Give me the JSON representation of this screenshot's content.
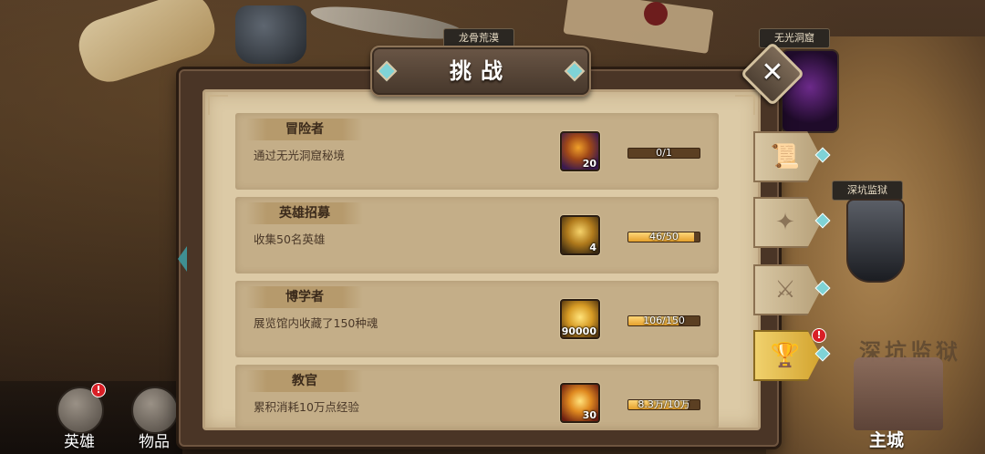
{
  "dialog": {
    "title": "挑战",
    "close_symbol": "✕"
  },
  "map": {
    "locations": [
      "龙骨荒漠",
      "无光洞窟",
      "深坑监狱"
    ],
    "map_text": "深坑监狱",
    "city_label": "主城"
  },
  "nav": {
    "heroes_label": "英雄",
    "items_label": "物品",
    "heroes_badge": "!"
  },
  "challenges": [
    {
      "title": "冒险者",
      "desc": "通过无光洞窟秘境",
      "reward_icon": "purple-chest-icon",
      "reward_qty": "20",
      "progress_text": "0/1",
      "progress": 0
    },
    {
      "title": "英雄招募",
      "desc": "收集50名英雄",
      "reward_icon": "golden-key-icon",
      "reward_qty": "4",
      "progress_text": "46/50",
      "progress": 0.92
    },
    {
      "title": "博学者",
      "desc": "展览馆内收藏了150种魂",
      "reward_icon": "gold-coin-icon",
      "reward_qty": "90000",
      "progress_text": "106/150",
      "progress": 0.707
    },
    {
      "title": "教官",
      "desc": "累积消耗10万点经验",
      "reward_icon": "exp-orb-icon",
      "reward_qty": "30",
      "progress_text": "8.3万/10万",
      "progress": 0.83
    }
  ],
  "side_tabs": [
    {
      "icon": "scroll-icon",
      "glyph": "📜",
      "active": false
    },
    {
      "icon": "book-icon",
      "glyph": "✦",
      "active": false
    },
    {
      "icon": "crossed-swords-icon",
      "glyph": "⚔",
      "active": false
    },
    {
      "icon": "trophy-icon",
      "glyph": "🏆",
      "active": true
    }
  ],
  "side_badge": "!"
}
